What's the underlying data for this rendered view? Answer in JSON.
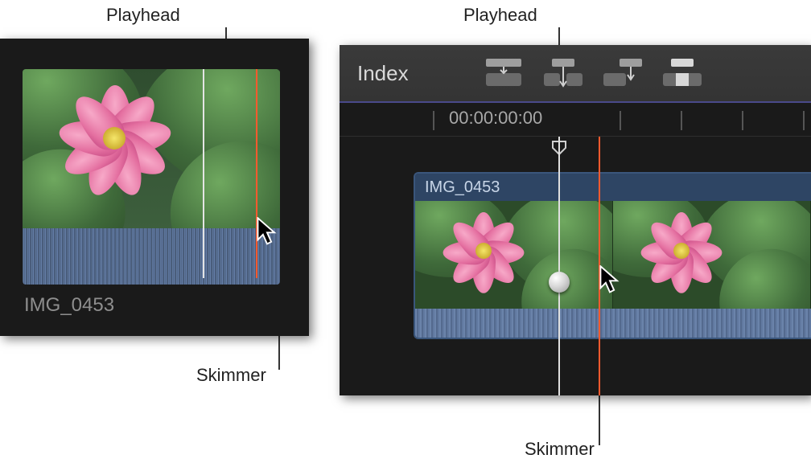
{
  "callouts": {
    "playhead_left": "Playhead",
    "skimmer_left": "Skimmer",
    "playhead_right": "Playhead",
    "skimmer_right": "Skimmer"
  },
  "browser": {
    "clip_name": "IMG_0453"
  },
  "timeline": {
    "index_button": "Index",
    "timecode": "00:00:00:00",
    "clip_name": "IMG_0453"
  },
  "icons": {
    "connect_clip": "connect-clip-icon",
    "insert_clip": "insert-clip-icon",
    "append_clip": "append-clip-icon",
    "overwrite_clip": "overwrite-clip-icon"
  },
  "colors": {
    "skimmer": "#ff5a2e",
    "playhead": "#e0e0e0",
    "clip_header": "#2e4564"
  }
}
